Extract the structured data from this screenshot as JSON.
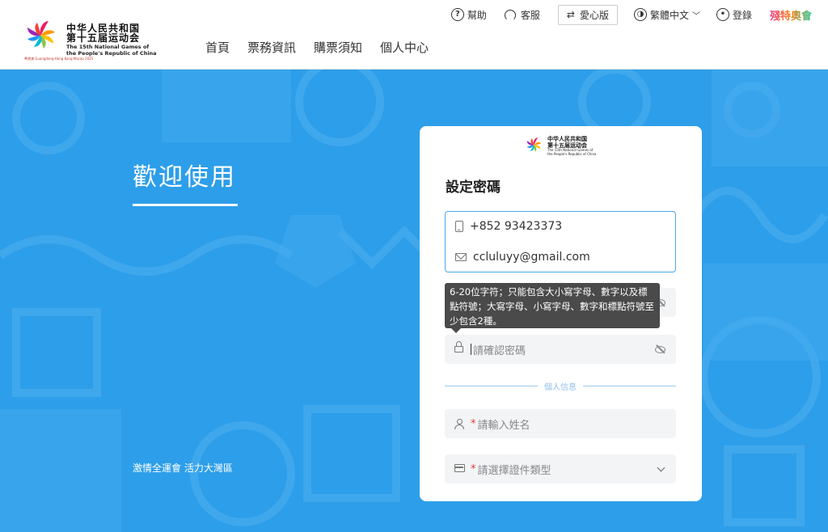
{
  "header": {
    "logo_cn_1": "中华人民共和国",
    "logo_cn_2": "第十五届运动会",
    "logo_en_1": "The 15th National Games of",
    "logo_en_2": "the People's Republic of China",
    "logo_sub": "粤港澳 Guangdong·Hong Kong·Macao 2025",
    "nav": [
      "首頁",
      "票務資訊",
      "購票須知",
      "個人中心"
    ],
    "topbar": {
      "help": "幫助",
      "service": "客服",
      "accessible": "愛心版",
      "language": "繁體中文",
      "login": "登錄",
      "paralympic": "殘特奧會"
    }
  },
  "hero": {
    "welcome": "歡迎使用",
    "slogan": "激情全運會 活力大灣區"
  },
  "card": {
    "logo_cn_1": "中华人民共和国",
    "logo_cn_2": "第十五届运动会",
    "logo_en_1": "The 15th National Games of",
    "logo_en_2": "the People's Republic of China",
    "title": "設定密碼",
    "phone": "+852 93423373",
    "email": "ccluluyy@gmail.com",
    "tooltip": "6-20位字符；只能包含大小寫字母、數字以及標點符號；大寫字母、小寫字母、數字和標點符號至少包含2種。",
    "confirm_password_placeholder": "請確認密碼",
    "section_label": "個人信息",
    "name_required": "*",
    "name_placeholder": "請輸入姓名",
    "id_type_required": "*",
    "id_type_placeholder": "請選擇證件類型"
  },
  "colors": {
    "brand_blue": "#2d9ee9",
    "focus_blue": "#4aa8ec",
    "required_red": "#e53935"
  }
}
